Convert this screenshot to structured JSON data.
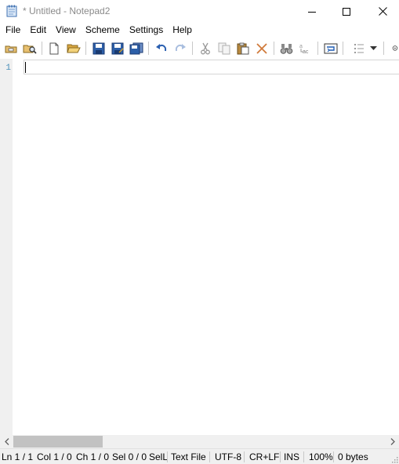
{
  "window": {
    "title": "* Untitled - Notepad2"
  },
  "menu": {
    "items": [
      "File",
      "Edit",
      "View",
      "Scheme",
      "Settings",
      "Help"
    ]
  },
  "toolbar": {
    "buttons": [
      {
        "name": "browse-button",
        "icon": "folder-browse-icon"
      },
      {
        "name": "find-file-button",
        "icon": "find-file-icon"
      },
      {
        "name": "new-button",
        "icon": "new-file-icon"
      },
      {
        "name": "open-button",
        "icon": "open-folder-icon"
      },
      {
        "name": "save-button",
        "icon": "save-icon"
      },
      {
        "name": "save-as-button",
        "icon": "save-as-icon"
      },
      {
        "name": "save-copy-button",
        "icon": "save-copy-icon"
      },
      {
        "name": "undo-button",
        "icon": "undo-icon"
      },
      {
        "name": "redo-button",
        "icon": "redo-icon"
      },
      {
        "name": "cut-button",
        "icon": "cut-icon"
      },
      {
        "name": "copy-button",
        "icon": "copy-icon"
      },
      {
        "name": "paste-button",
        "icon": "paste-icon"
      },
      {
        "name": "delete-button",
        "icon": "delete-icon"
      },
      {
        "name": "find-button",
        "icon": "binoculars-icon"
      },
      {
        "name": "replace-button",
        "icon": "replace-icon"
      },
      {
        "name": "word-wrap-button",
        "icon": "word-wrap-icon"
      },
      {
        "name": "view-options-button",
        "icon": "list-icon"
      },
      {
        "name": "dropdown-button",
        "icon": "chevron-down-icon"
      },
      {
        "name": "zoom-button",
        "icon": "zoom-icon"
      }
    ]
  },
  "editor": {
    "line_numbers": [
      "1"
    ],
    "content": ""
  },
  "status": {
    "ln": "Ln 1 / 1",
    "col": "Col 1 / 0",
    "ch": "Ch 1 / 0",
    "sel": "Sel 0 / 0",
    "sell": "SelL",
    "type": "Text File",
    "encoding": "UTF-8",
    "eol": "CR+LF",
    "mode": "INS",
    "zoom": "100%",
    "size": "0 bytes"
  },
  "colors": {
    "accent": "#1e5cb3",
    "line_number": "#4a8fb8",
    "status_bg": "#f0f0f0"
  }
}
